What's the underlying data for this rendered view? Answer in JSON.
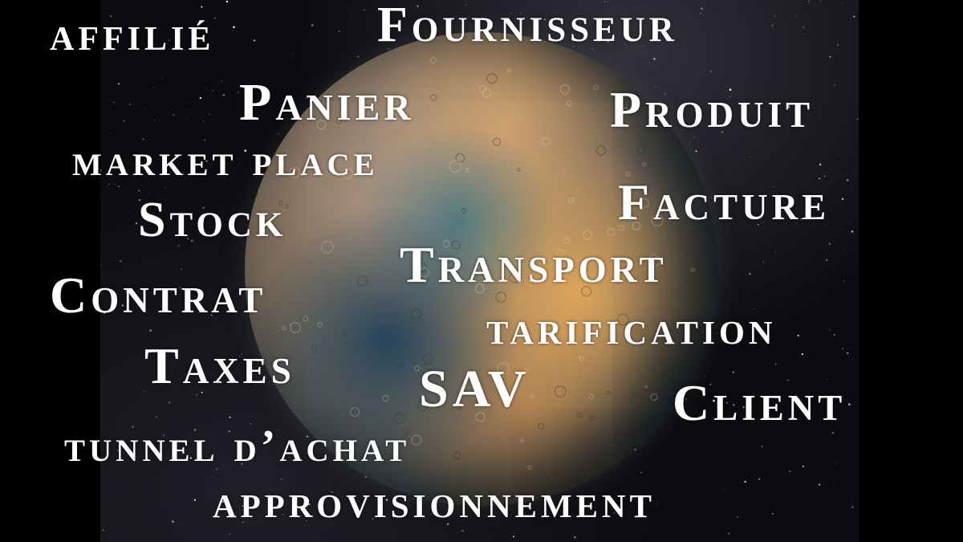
{
  "words": {
    "affilie": "affilié",
    "fournisseur": "Fournisseur",
    "panier": "Panier",
    "produit": "Produit",
    "market_place": "market place",
    "stock": "Stock",
    "facture": "Facture",
    "transport": "Transport",
    "contrat": "Contrat",
    "tarification": "tarification",
    "taxes": "Taxes",
    "sav": "SAV",
    "client": "Client",
    "tunnel_achat": "tunnel d’achat",
    "approvisionnement": "approvisionnement"
  },
  "colors": {
    "text": "#ffffff",
    "background": "#000000"
  },
  "background": {
    "image": "planet-in-starfield",
    "icon": "planet-icon"
  }
}
